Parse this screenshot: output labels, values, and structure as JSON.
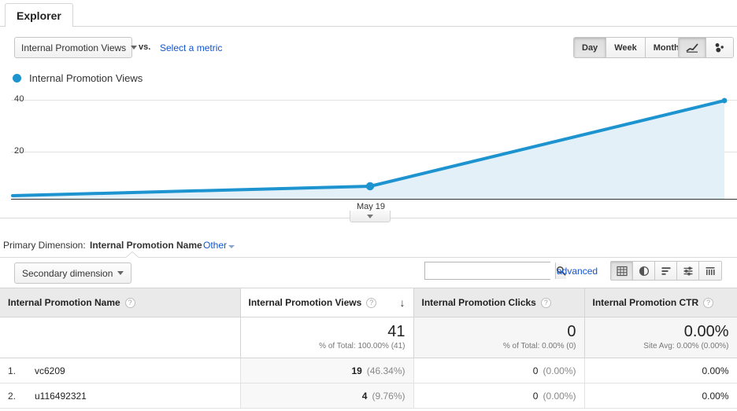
{
  "tabs": [
    {
      "label": "Explorer",
      "active": true
    }
  ],
  "metric_bar": {
    "primary_metric": "Internal Promotion Views",
    "vs_label": "vs.",
    "select_metric_link": "Select a metric",
    "caret_icon": "chevron-down-icon"
  },
  "granularity": {
    "options": [
      "Day",
      "Week",
      "Month"
    ],
    "selected": "Day"
  },
  "viz_toggle": {
    "options": [
      "line-chart-icon",
      "motion-chart-icon"
    ],
    "selected": "line-chart-icon"
  },
  "legend": {
    "series_label": "Internal Promotion Views",
    "series_color": "#1d94cf"
  },
  "chart_data": {
    "type": "line",
    "title": "",
    "xlabel": "",
    "ylabel": "",
    "series": [
      {
        "name": "Internal Promotion Views",
        "color": "#1d94cf",
        "fill_color": "#e4f0f7",
        "x": [
          "",
          "May 19",
          ""
        ],
        "values": [
          1,
          3,
          40
        ]
      }
    ],
    "x_tick_labels": [
      "May 19"
    ],
    "y_tick_labels": [
      "40",
      "20"
    ],
    "ylim": [
      0,
      46
    ],
    "grid": true,
    "legend_position": "top-left",
    "markers": [
      {
        "x_label": "May 19",
        "value": 3
      }
    ]
  },
  "primary_dimension": {
    "label": "Primary Dimension:",
    "value": "Internal Promotion Name",
    "other_link": "Other",
    "caret_icon": "chevron-down-icon"
  },
  "table_toolbar": {
    "secondary_dimension_label": "Secondary dimension",
    "secondary_dimension_caret": "chevron-down-icon",
    "search_value": "",
    "search_placeholder": "",
    "search_icon": "search-icon",
    "advanced_link": "advanced",
    "view_types": [
      "table-view-icon",
      "pie-chart-view-icon",
      "performance-view-icon",
      "comparison-view-icon",
      "pivot-view-icon"
    ],
    "view_type_selected": "table-view-icon"
  },
  "table": {
    "columns": [
      {
        "label": "Internal Promotion Name",
        "help": "?",
        "sorted": false
      },
      {
        "label": "Internal Promotion Views",
        "help": "?",
        "sorted": true,
        "sort_arrow": "↓"
      },
      {
        "label": "Internal Promotion Clicks",
        "help": "?",
        "sorted": false
      },
      {
        "label": "Internal Promotion CTR",
        "help": "?",
        "sorted": false
      }
    ],
    "totals": {
      "views_value": "41",
      "views_sub": "% of Total: 100.00% (41)",
      "clicks_value": "0",
      "clicks_sub": "% of Total: 0.00% (0)",
      "ctr_value": "0.00%",
      "ctr_sub": "Site Avg: 0.00% (0.00%)"
    },
    "rows": [
      {
        "index": "1.",
        "name": "vc6209",
        "views": "19",
        "views_pct": "(46.34%)",
        "clicks": "0",
        "clicks_pct": "(0.00%)",
        "ctr": "0.00%"
      },
      {
        "index": "2.",
        "name": "u116492321",
        "views": "4",
        "views_pct": "(9.76%)",
        "clicks": "0",
        "clicks_pct": "(0.00%)",
        "ctr": "0.00%"
      }
    ]
  }
}
